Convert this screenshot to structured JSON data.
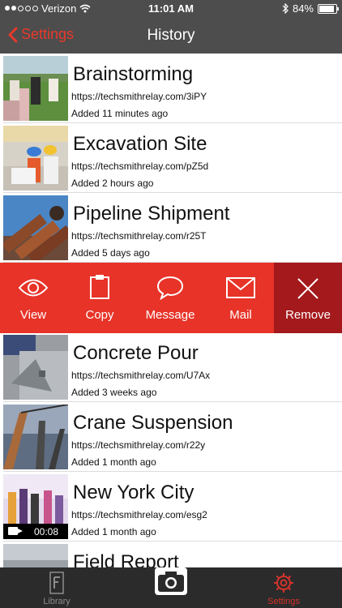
{
  "status": {
    "carrier": "Verizon",
    "time": "11:01 AM",
    "battery": "84%",
    "battery_level": 0.84
  },
  "nav": {
    "back_label": "Settings",
    "title": "History"
  },
  "history": [
    {
      "title": "Brainstorming",
      "url": "https://techsmithrelay.com/3iPY",
      "added": "Added 11 minutes ago"
    },
    {
      "title": "Excavation Site",
      "url": "https://techsmithrelay.com/pZ5d",
      "added": "Added 2 hours ago"
    },
    {
      "title": "Pipeline Shipment",
      "url": "https://techsmithrelay.com/r25T",
      "added": "Added 5 days ago"
    },
    {
      "title": "Concrete Pour",
      "url": "https://techsmithrelay.com/U7Ax",
      "added": "Added 3 weeks ago"
    },
    {
      "title": "Crane Suspension",
      "url": "https://techsmithrelay.com/r22y",
      "added": "Added 1 month ago"
    },
    {
      "title": "New York City",
      "url": "https://techsmithrelay.com/esg2",
      "added": "Added 1 month ago",
      "duration": "00:08"
    },
    {
      "title": "Field Report"
    }
  ],
  "actions": {
    "view": "View",
    "copy": "Copy",
    "message": "Message",
    "mail": "Mail",
    "remove": "Remove"
  },
  "tabbar": {
    "library": "Library",
    "settings": "Settings"
  },
  "colors": {
    "accent": "#e73328",
    "remove": "#a4191c",
    "bar": "#4d4d4d",
    "tabbar": "#2b2b2b"
  }
}
